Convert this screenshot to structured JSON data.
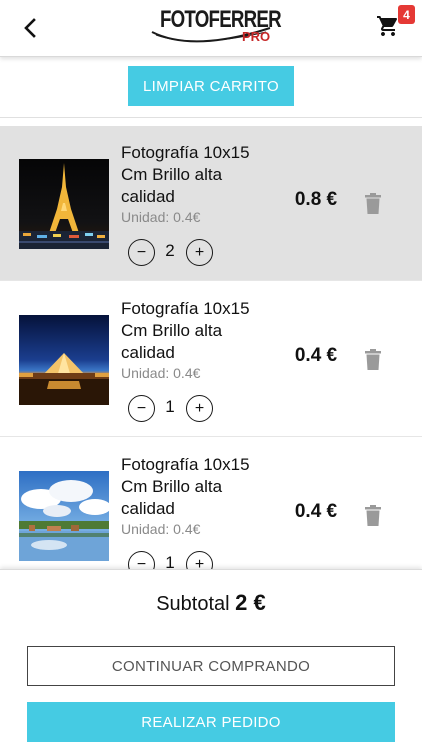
{
  "header": {
    "back_icon": "chevron-left-icon",
    "logo": {
      "main": "FOTOFERRER",
      "sub": "PRO"
    },
    "cart_icon": "cart-icon",
    "cart_count": "4"
  },
  "actions": {
    "clear_label": "LIMPIAR CARRITO"
  },
  "cart": {
    "items": [
      {
        "name": "Fotografía 10x15 Cm Brillo alta calidad",
        "unit": "Unidad: 0.4€",
        "quantity": "2",
        "price": "0.8 €",
        "thumb": "eiffel-tower-night-photo",
        "selected": true
      },
      {
        "name": "Fotografía 10x15 Cm Brillo alta calidad",
        "unit": "Unidad: 0.4€",
        "quantity": "1",
        "price": "0.4 €",
        "thumb": "louvre-pyramid-night-photo",
        "selected": false
      },
      {
        "name": "Fotografía 10x15 Cm Brillo alta calidad",
        "unit": "Unidad: 0.4€",
        "quantity": "1",
        "price": "0.4 €",
        "thumb": "versailles-garden-sky-photo",
        "selected": false
      }
    ]
  },
  "footer": {
    "subtotal_label": "Subtotal",
    "subtotal_value": "2 €",
    "continue_label": "CONTINUAR COMPRANDO",
    "order_label": "REALIZAR PEDIDO"
  },
  "colors": {
    "accent": "#45cbe3",
    "badge": "#e53935",
    "selected_row": "#e1e1e1"
  }
}
